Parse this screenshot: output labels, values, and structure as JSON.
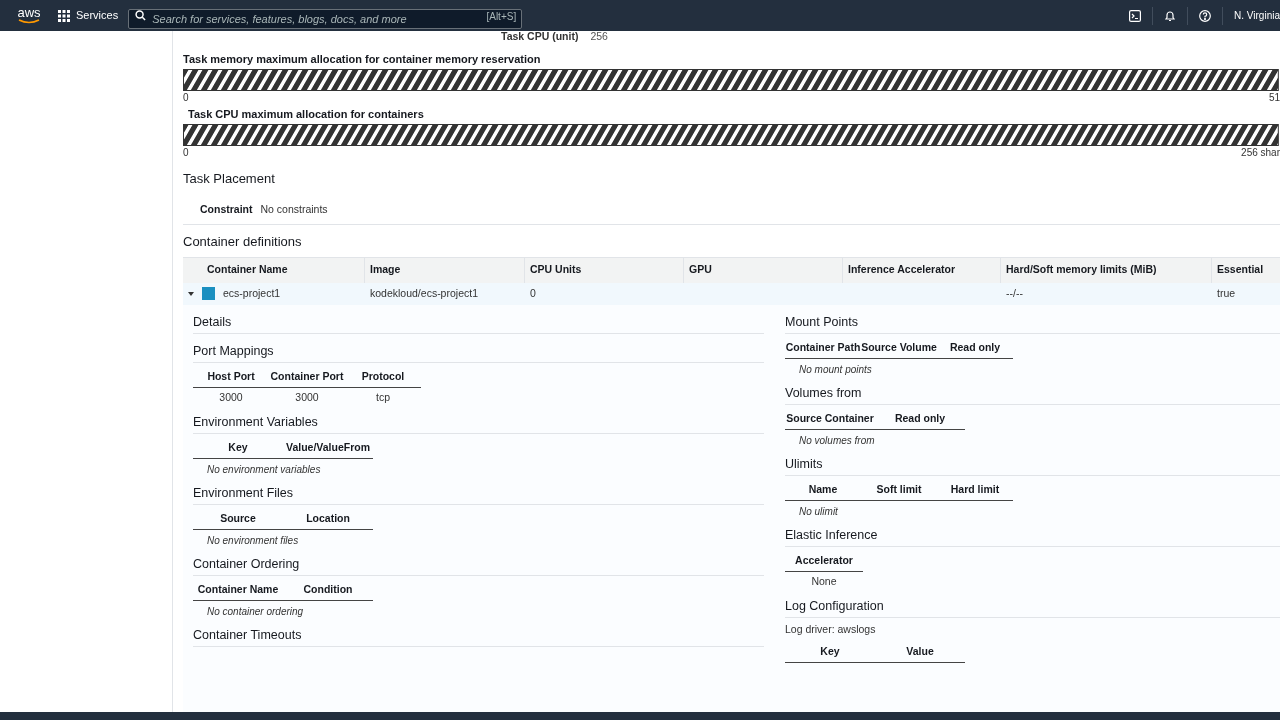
{
  "header": {
    "logo": "aws",
    "services": "Services",
    "search": {
      "placeholder": "Search for services, features, blogs, docs, and more",
      "shortcut": "[Alt+S]"
    },
    "region": "N. Virginia"
  },
  "task_cpu": {
    "label": "Task CPU (unit)",
    "value": "256"
  },
  "allocation_bars": [
    {
      "title": "Task memory maximum allocation for container memory reservation",
      "min": "0",
      "max": "51"
    },
    {
      "title": "Task CPU maximum allocation for containers",
      "min": "0",
      "max": "256 shar"
    }
  ],
  "task_placement": {
    "title": "Task Placement",
    "label": "Constraint",
    "value": "No constraints"
  },
  "container_definitions": {
    "title": "Container definitions",
    "columns": [
      "Container Name",
      "Image",
      "CPU Units",
      "GPU",
      "Inference Accelerator",
      "Hard/Soft memory limits (MiB)",
      "Essential"
    ],
    "rows": [
      {
        "expanded": true,
        "color": "#1a8fc0",
        "cells": [
          "ecs-project1",
          "kodekloud/ecs-project1",
          "0",
          "",
          "",
          "--/--",
          "true"
        ]
      }
    ]
  },
  "left_sections": [
    {
      "title": "Details"
    },
    {
      "title": "Port Mappings",
      "columns": [
        "Host Port",
        "Container Port",
        "Protocol"
      ],
      "rows": [
        [
          "3000",
          "3000",
          "tcp"
        ]
      ]
    },
    {
      "title": "Environment Variables",
      "columns": [
        "Key",
        "Value/ValueFrom"
      ],
      "empty": "No environment variables"
    },
    {
      "title": "Environment Files",
      "columns": [
        "Source",
        "Location"
      ],
      "empty": "No environment files"
    },
    {
      "title": "Container Ordering",
      "columns": [
        "Container Name",
        "Condition"
      ],
      "empty": "No container ordering"
    },
    {
      "title": "Container Timeouts"
    }
  ],
  "right_sections": [
    {
      "title": "Mount Points",
      "columns": [
        "Container Path",
        "Source Volume",
        "Read only"
      ],
      "empty": "No mount points"
    },
    {
      "title": "Volumes from",
      "columns": [
        "Source Container",
        "Read only"
      ],
      "empty": "No volumes from"
    },
    {
      "title": "Ulimits",
      "columns": [
        "Name",
        "Soft limit",
        "Hard limit"
      ],
      "empty": "No ulimit"
    },
    {
      "title": "Elastic Inference",
      "columns": [
        "Accelerator"
      ],
      "rows": [
        [
          "None"
        ]
      ]
    },
    {
      "title": "Log Configuration",
      "note": "Log driver: awslogs",
      "columns": [
        "Key",
        "Value"
      ]
    }
  ]
}
